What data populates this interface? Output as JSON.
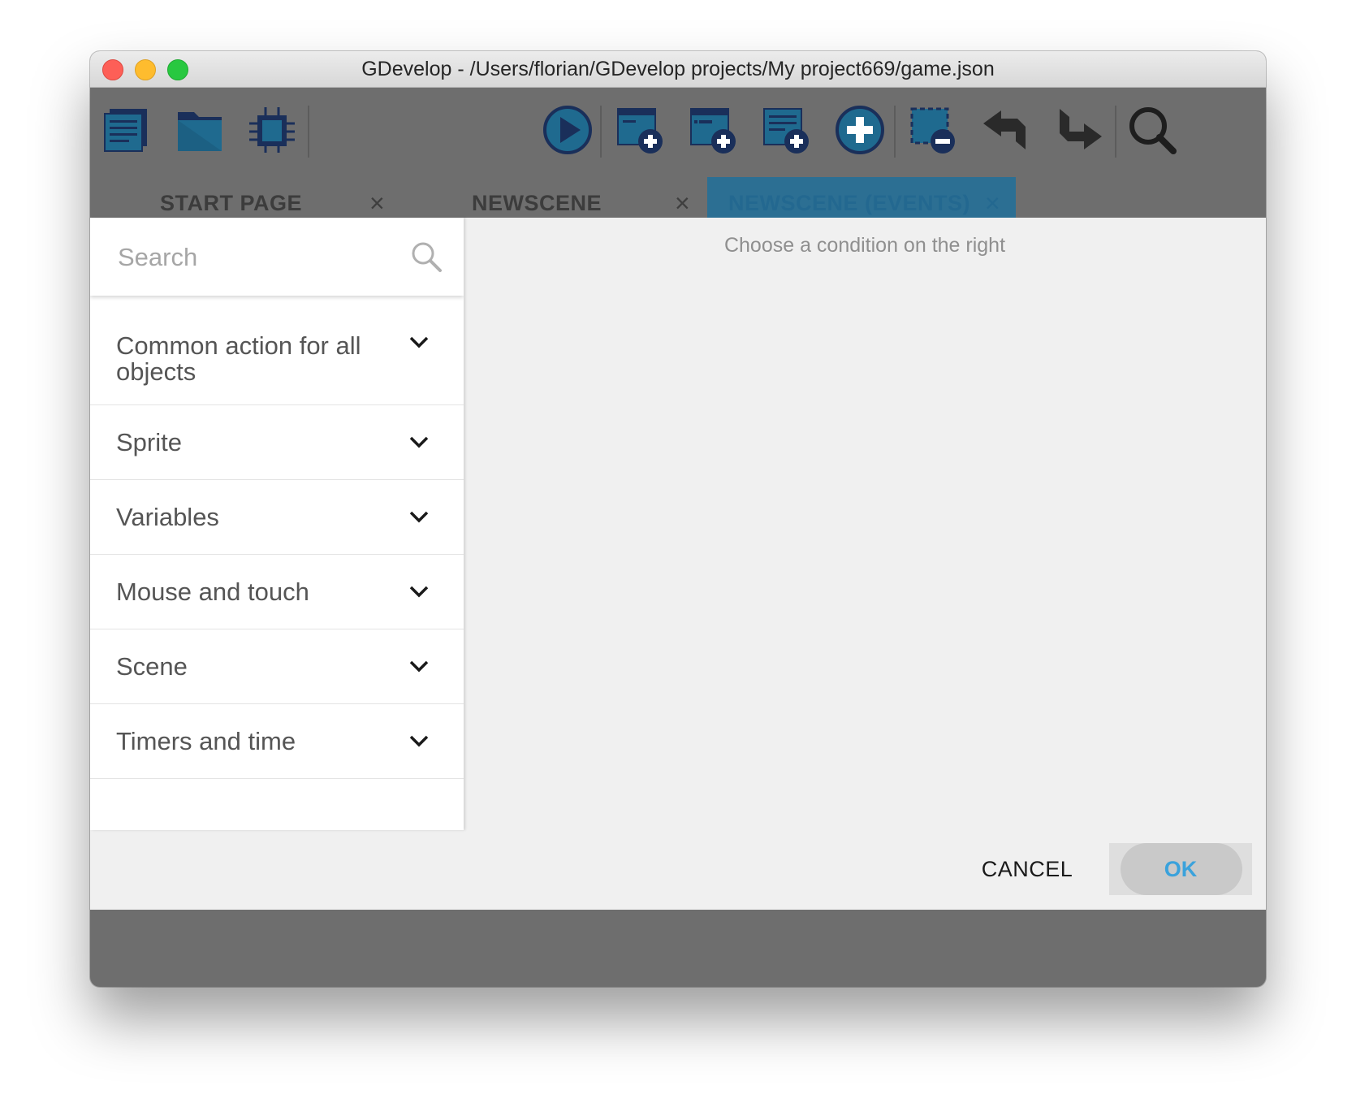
{
  "window": {
    "title": "GDevelop - /Users/florian/GDevelop projects/My project669/game.json"
  },
  "toolbar": {
    "icons": [
      "project-manager-icon",
      "open-folder-icon",
      "debugger-icon",
      "preview-play-icon",
      "add-event-icon",
      "add-sub-event-icon",
      "add-comment-icon",
      "add-instruction-icon",
      "delete-selection-icon",
      "undo-icon",
      "redo-icon",
      "search-icon"
    ]
  },
  "tabs": [
    {
      "label": "START PAGE",
      "close": "×",
      "active": false
    },
    {
      "label": "NEWSCENE",
      "close": "×",
      "active": false
    },
    {
      "label": "NEWSCENE (EVENTS)",
      "close": "×",
      "active": true
    }
  ],
  "dialog": {
    "search": {
      "placeholder": "Search",
      "value": ""
    },
    "categories": [
      {
        "label": "Common action for all objects"
      },
      {
        "label": "Sprite"
      },
      {
        "label": "Variables"
      },
      {
        "label": "Mouse and touch"
      },
      {
        "label": "Scene"
      },
      {
        "label": "Timers and time"
      }
    ],
    "hint": "Choose a condition on the right",
    "cancel_label": "CANCEL",
    "ok_label": "OK"
  },
  "colors": {
    "toolbar_background": "#6e6e6e",
    "active_tab": "#2c6f93",
    "icon_blue": "#1f6a8f",
    "icon_navy": "#1a2f5a",
    "ok_blue": "#3aa2dc"
  }
}
